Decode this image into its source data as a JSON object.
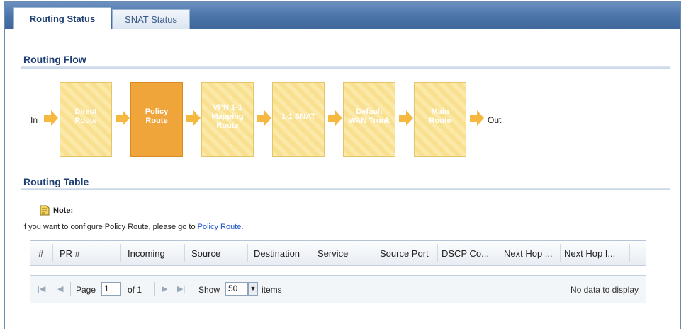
{
  "tabs": [
    "Routing Status",
    "SNAT Status"
  ],
  "routing_flow": {
    "title": "Routing Flow",
    "in_label": "In",
    "out_label": "Out",
    "boxes": [
      "Direct\nRoute",
      "Policy\nRoute",
      "VPN 1-1\nMapping\nRoute",
      "1-1 SNAT",
      "Default\nWAN Trunk",
      "Main\nRoute"
    ],
    "active_box": "Policy Route"
  },
  "routing_table": {
    "title": "Routing Table",
    "note_title": "Note:",
    "note_text": "If you want to configure Policy Route, please go to ",
    "note_link": "Policy Route",
    "note_end": ".",
    "columns": [
      "#",
      "PR #",
      "Incoming",
      "Source",
      "Destination",
      "Service",
      "Source Port",
      "DSCP Co...",
      "Next Hop ...",
      "Next Hop I..."
    ],
    "pager": {
      "page_label": "Page",
      "page_value": "1",
      "of_label": "of 1",
      "show_label": "Show",
      "show_value": "50",
      "items_label": "items",
      "empty_text": "No data to display"
    }
  },
  "colors": {
    "accent": "#1d3f73",
    "active_box": "#f0a53a",
    "box": "#fbe9a8",
    "arrow": "#f5b941"
  }
}
